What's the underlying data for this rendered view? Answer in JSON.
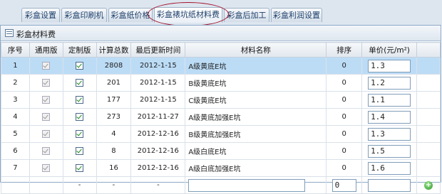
{
  "tabs": [
    {
      "label": "彩盒设置"
    },
    {
      "label": "彩盒印刷机"
    },
    {
      "label": "彩盒纸价格"
    },
    {
      "label": "彩盒裱坑纸材料费"
    },
    {
      "label": "彩盒后加工"
    },
    {
      "label": "彩盒利润设置"
    }
  ],
  "panel": {
    "title": "彩盒材料费"
  },
  "table": {
    "headers": [
      "序号",
      "通用版",
      "定制版",
      "计算总数",
      "最后更新时间",
      "材料名称",
      "排序",
      "单价(元/m²)"
    ],
    "rows": [
      {
        "no": "1",
        "total": "2808",
        "updated": "2012-1-15",
        "name": "A级黄底E坑",
        "sort": "0",
        "price": "1.3"
      },
      {
        "no": "2",
        "total": "201",
        "updated": "2012-1-15",
        "name": "B级黄底E坑",
        "sort": "0",
        "price": "1.2"
      },
      {
        "no": "3",
        "total": "177",
        "updated": "2012-1-15",
        "name": "C级黄底E坑",
        "sort": "0",
        "price": "1.1"
      },
      {
        "no": "4",
        "total": "273",
        "updated": "2012-11-27",
        "name": "A级黄底加强E坑",
        "sort": "0",
        "price": "1.4"
      },
      {
        "no": "5",
        "total": "4",
        "updated": "2012-12-16",
        "name": "B级黄底加强E坑",
        "sort": "0",
        "price": "1.3"
      },
      {
        "no": "6",
        "total": "8",
        "updated": "2012-12-16",
        "name": "A级白底E坑",
        "sort": "0",
        "price": "1.5"
      },
      {
        "no": "7",
        "total": "16",
        "updated": "2012-12-16",
        "name": "A级白底加强E坑",
        "sort": "0",
        "price": "1.6"
      }
    ],
    "new_row": {
      "dash1": "-",
      "dash2": "-",
      "dash3": "-",
      "sort_value": "0"
    }
  },
  "colors": {
    "selected_row": "#bcdcf6",
    "tab_text": "#1d3f6a",
    "ring": "#a2122c",
    "check": "#1e8a1e"
  }
}
